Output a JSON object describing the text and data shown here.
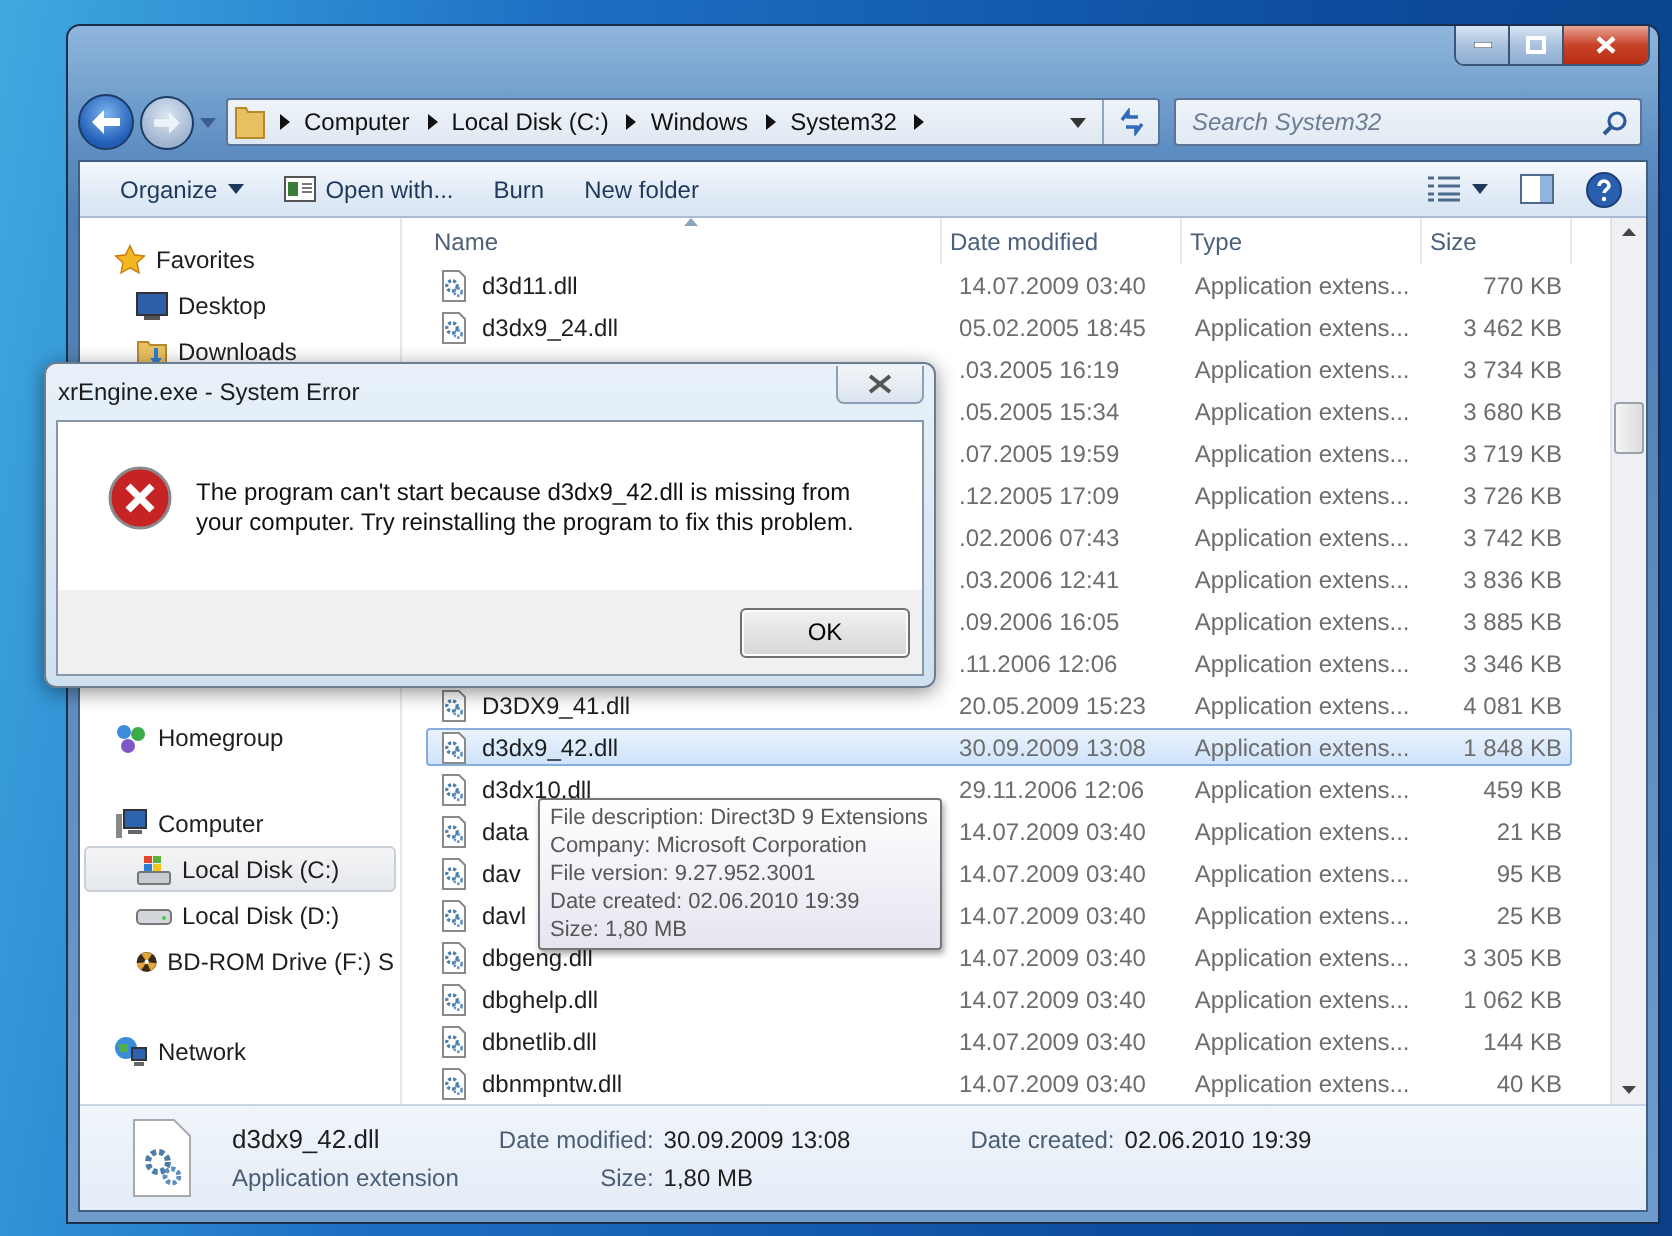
{
  "nav": {
    "breadcrumbs": [
      "Computer",
      "Local Disk (C:)",
      "Windows",
      "System32"
    ],
    "search": {
      "placeholder": "Search System32"
    }
  },
  "toolbar": [
    {
      "label": "Organize",
      "kind": "menu"
    },
    {
      "label": "Open with...",
      "kind": "app"
    },
    {
      "label": "Burn",
      "kind": "plain"
    },
    {
      "label": "New folder",
      "kind": "plain"
    }
  ],
  "sidebar": [
    {
      "label": "Favorites",
      "kind": "favorites",
      "selected": false,
      "children": [
        {
          "label": "Desktop",
          "kind": "desktop",
          "selected": false
        },
        {
          "label": "Downloads",
          "kind": "downloads",
          "selected": false
        }
      ]
    },
    {
      "label": "Homegroup",
      "kind": "homegroup",
      "selected": false
    },
    {
      "label": "Computer",
      "kind": "computer",
      "selected": false,
      "children": [
        {
          "label": "Local Disk (C:)",
          "kind": "system-drive",
          "selected": true
        },
        {
          "label": "Local Disk (D:)",
          "kind": "drive",
          "selected": false
        },
        {
          "label": "BD-ROM Drive (F:) S",
          "kind": "optical-drive",
          "selected": false
        }
      ]
    },
    {
      "label": "Network",
      "kind": "network",
      "selected": false
    }
  ],
  "table": {
    "columns": [
      {
        "label": "Name",
        "sorted": true
      },
      {
        "label": "Date modified",
        "sorted": false
      },
      {
        "label": "Type",
        "sorted": false
      },
      {
        "label": "Size",
        "sorted": false
      }
    ],
    "rows": [
      {
        "name": "d3d11.dll",
        "date": "14.07.2009 03:40",
        "type": "Application extens...",
        "size": "770 KB",
        "selected": false
      },
      {
        "name": "d3dx9_24.dll",
        "date": "05.02.2005 18:45",
        "type": "Application extens...",
        "size": "3 462 KB",
        "selected": false
      },
      {
        "date": ".03.2005 16:19",
        "type": "Application extens...",
        "size": "3 734 KB",
        "selected": false
      },
      {
        "date": ".05.2005 15:34",
        "type": "Application extens...",
        "size": "3 680 KB",
        "selected": false
      },
      {
        "date": ".07.2005 19:59",
        "type": "Application extens...",
        "size": "3 719 KB",
        "selected": false
      },
      {
        "date": ".12.2005 17:09",
        "type": "Application extens...",
        "size": "3 726 KB",
        "selected": false
      },
      {
        "date": ".02.2006 07:43",
        "type": "Application extens...",
        "size": "3 742 KB",
        "selected": false
      },
      {
        "date": ".03.2006 12:41",
        "type": "Application extens...",
        "size": "3 836 KB",
        "selected": false
      },
      {
        "date": ".09.2006 16:05",
        "type": "Application extens...",
        "size": "3 885 KB",
        "selected": false
      },
      {
        "date": ".11.2006 12:06",
        "type": "Application extens...",
        "size": "3 346 KB",
        "selected": false
      },
      {
        "name": "D3DX9_41.dll",
        "date": "20.05.2009 15:23",
        "type": "Application extens...",
        "size": "4 081 KB",
        "selected": false
      },
      {
        "name": "d3dx9_42.dll",
        "date": "30.09.2009 13:08",
        "type": "Application extens...",
        "size": "1 848 KB",
        "selected": true
      },
      {
        "name": "d3dx10.dll",
        "date": "29.11.2006 12:06",
        "type": "Application extens...",
        "size": "459 KB",
        "selected": false
      },
      {
        "name": "data",
        "date": "14.07.2009 03:40",
        "type": "Application extens...",
        "size": "21 KB",
        "selected": false
      },
      {
        "name": "dav",
        "date": "14.07.2009 03:40",
        "type": "Application extens...",
        "size": "95 KB",
        "selected": false
      },
      {
        "name": "davl",
        "date": "14.07.2009 03:40",
        "type": "Application extens...",
        "size": "25 KB",
        "selected": false
      },
      {
        "name": "dbgeng.dll",
        "date": "14.07.2009 03:40",
        "type": "Application extens...",
        "size": "3 305 KB",
        "selected": false
      },
      {
        "name": "dbghelp.dll",
        "date": "14.07.2009 03:40",
        "type": "Application extens...",
        "size": "1 062 KB",
        "selected": false
      },
      {
        "name": "dbnetlib.dll",
        "date": "14.07.2009 03:40",
        "type": "Application extens...",
        "size": "144 KB",
        "selected": false
      },
      {
        "name": "dbnmpntw.dll",
        "date": "14.07.2009 03:40",
        "type": "Application extens...",
        "size": "40 KB",
        "selected": false
      }
    ]
  },
  "tooltip": [
    "File description: Direct3D 9 Extensions",
    "Company: Microsoft Corporation",
    "File version: 9.27.952.3001",
    "Date created: 02.06.2010 19:39",
    "Size: 1,80 MB"
  ],
  "details": {
    "name": "d3dx9_42.dll",
    "type": "Application extension",
    "fields": [
      {
        "label": "Date modified:",
        "value": "30.09.2009 13:08"
      },
      {
        "label": "Size:",
        "value": "1,80 MB"
      },
      {
        "label": "Date created:",
        "value": "02.06.2010 19:39"
      }
    ]
  },
  "dialog": {
    "title": "xrEngine.exe - System Error",
    "message": "The program can't start because d3dx9_42.dll is missing from your computer. Try reinstalling the program to fix this problem.",
    "button": "OK"
  }
}
